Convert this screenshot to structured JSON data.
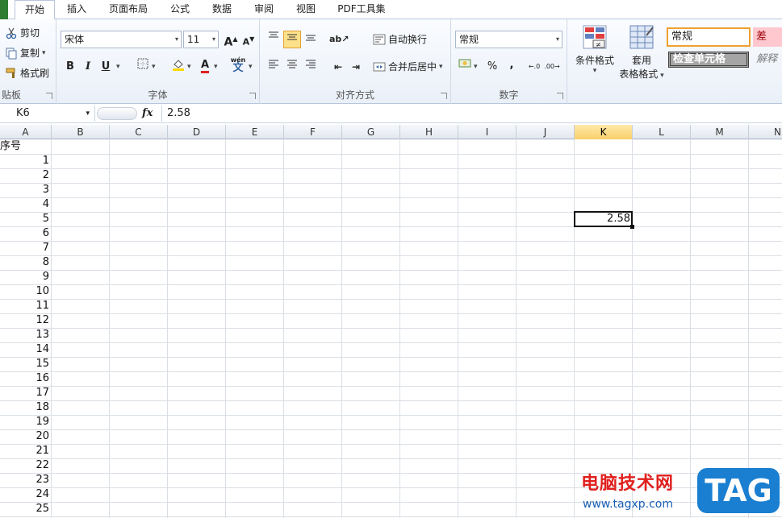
{
  "tabs": [
    "开始",
    "插入",
    "页面布局",
    "公式",
    "数据",
    "审阅",
    "视图",
    "PDF工具集"
  ],
  "active_tab": "开始",
  "clipboard": {
    "cut": "剪切",
    "copy": "复制",
    "format_painter": "格式刷",
    "group_label": "贴板"
  },
  "font": {
    "name": "宋体",
    "size": "11",
    "bold": "B",
    "italic": "I",
    "underline": "U",
    "grow": "A",
    "shrink": "A",
    "group_label": "字体",
    "font_color": "#e02020",
    "fill_color": "#ffd700",
    "phonetic": "wén"
  },
  "alignment": {
    "wrap": "自动换行",
    "merge": "合并后居中",
    "group_label": "对齐方式"
  },
  "number": {
    "format": "常规",
    "percent": "%",
    "comma": ",",
    "inc_dec": ".0 .00",
    "group_label": "数字"
  },
  "styles": {
    "conditional": "条件格式",
    "table_format_1": "套用",
    "table_format_2": "表格格式",
    "normal": "常规",
    "bad": "差",
    "check_cell": "检查单元格",
    "explanatory": "解释"
  },
  "formula_bar": {
    "name_box": "K6",
    "fx": "fx",
    "value": "2.58"
  },
  "columns": [
    "A",
    "B",
    "C",
    "D",
    "E",
    "F",
    "G",
    "H",
    "I",
    "J",
    "K",
    "L",
    "M",
    "N"
  ],
  "selected_column": "K",
  "cells": {
    "A1": "序号",
    "A_values": [
      "1",
      "2",
      "3",
      "4",
      "5",
      "6",
      "7",
      "8",
      "9",
      "10",
      "11",
      "12",
      "13",
      "14",
      "15",
      "16",
      "17",
      "18",
      "19",
      "20",
      "21",
      "22",
      "23",
      "24",
      "25"
    ],
    "K6": "2.58"
  },
  "watermark": {
    "site_cn": "电脑技术网",
    "site_url": "www.tagxp.com",
    "badge": "TAG"
  },
  "colors": {
    "accent": "#2e7d32",
    "selected_header": "#f9cf6a",
    "normal_style_border": "#f0a030",
    "bad_style_bg": "#ffc7ce",
    "check_cell_bg": "#a5a5a5",
    "watermark_red": "#e0201e",
    "watermark_blue": "#1a5fb4"
  }
}
